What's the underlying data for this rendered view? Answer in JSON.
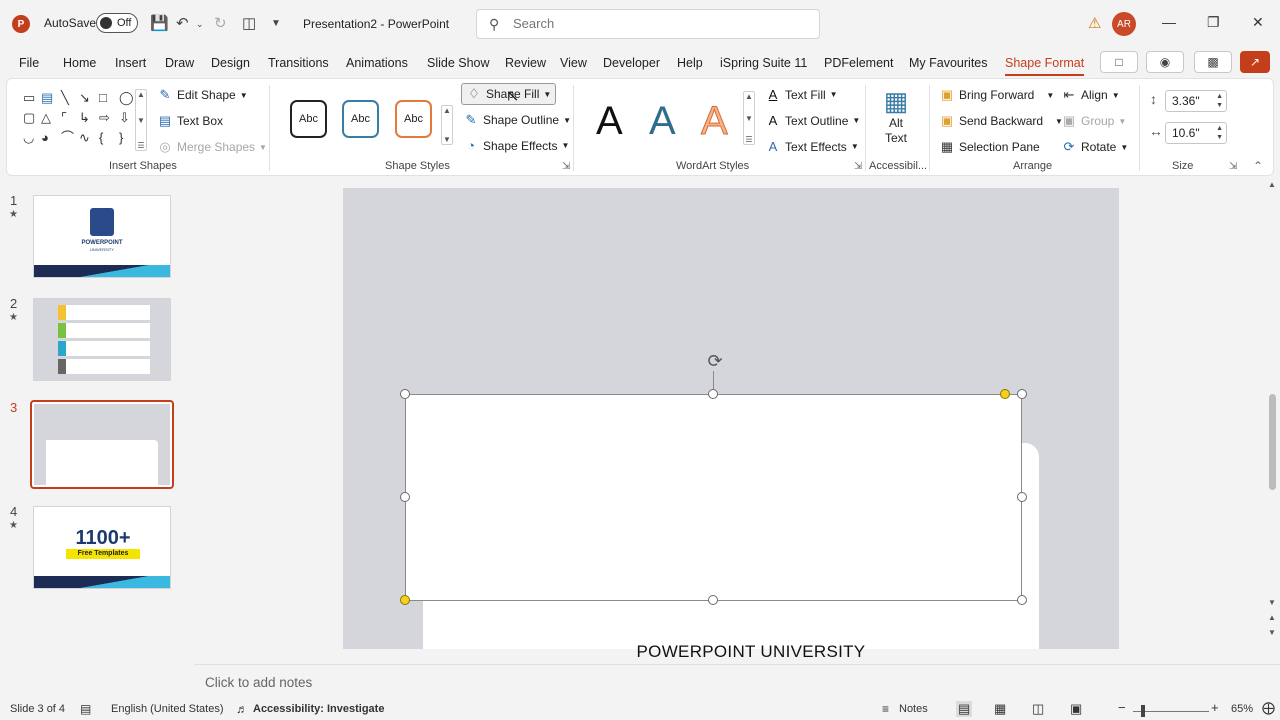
{
  "titlebar": {
    "app_icon": "P",
    "autosave_label": "AutoSave",
    "autosave_state": "Off",
    "doc_title": "Presentation2  -  PowerPoint",
    "search_placeholder": "Search",
    "avatar_initials": "AR",
    "icons": [
      "save-icon",
      "undo-icon",
      "redo-icon",
      "present-icon",
      "customize-icon",
      "warning-icon",
      "minimize-icon",
      "restore-icon",
      "close-icon"
    ]
  },
  "tabs": [
    "File",
    "Home",
    "Insert",
    "Draw",
    "Design",
    "Transitions",
    "Animations",
    "Slide Show",
    "Review",
    "View",
    "Developer",
    "Help",
    "iSpring Suite 11",
    "PDFelement",
    "My Favourites",
    "Shape Format"
  ],
  "active_tab": "Shape Format",
  "ribbon": {
    "insert_shapes": {
      "label": "Insert Shapes",
      "edit_shape": "Edit Shape",
      "text_box": "Text Box",
      "merge_shapes": "Merge Shapes"
    },
    "shape_styles": {
      "label": "Shape Styles",
      "preset": "Abc",
      "shape_fill": "Shape Fill",
      "shape_outline": "Shape Outline",
      "shape_effects": "Shape Effects"
    },
    "wordart": {
      "label": "WordArt Styles",
      "letter": "A",
      "text_fill": "Text Fill",
      "text_outline": "Text Outline",
      "text_effects": "Text Effects"
    },
    "accessibility": {
      "label": "Accessibil...",
      "alt_text_1": "Alt",
      "alt_text_2": "Text"
    },
    "arrange": {
      "label": "Arrange",
      "bring_forward": "Bring Forward",
      "send_backward": "Send Backward",
      "selection_pane": "Selection Pane",
      "align": "Align",
      "group": "Group",
      "rotate": "Rotate"
    },
    "size": {
      "label": "Size",
      "height": "3.36\"",
      "width": "10.6\""
    }
  },
  "slides": [
    {
      "number": "1",
      "star": "★",
      "title": "POWERPOINT",
      "subtitle": "UNIVERSITY"
    },
    {
      "number": "2",
      "star": "★"
    },
    {
      "number": "3",
      "star": "",
      "active": true
    },
    {
      "number": "4",
      "star": "★",
      "big": "1100+",
      "banner": "Free Templates"
    }
  ],
  "slide_text": "POWERPOINT UNIVERSITY",
  "notes_placeholder": "Click to add notes",
  "status": {
    "slide_info": "Slide 3 of 4",
    "language": "English (United States)",
    "accessibility": "Accessibility: Investigate",
    "notes": "Notes",
    "zoom": "65%"
  },
  "colors": {
    "accent": "#c43e1c",
    "handle_yellow": "#f5d219"
  }
}
